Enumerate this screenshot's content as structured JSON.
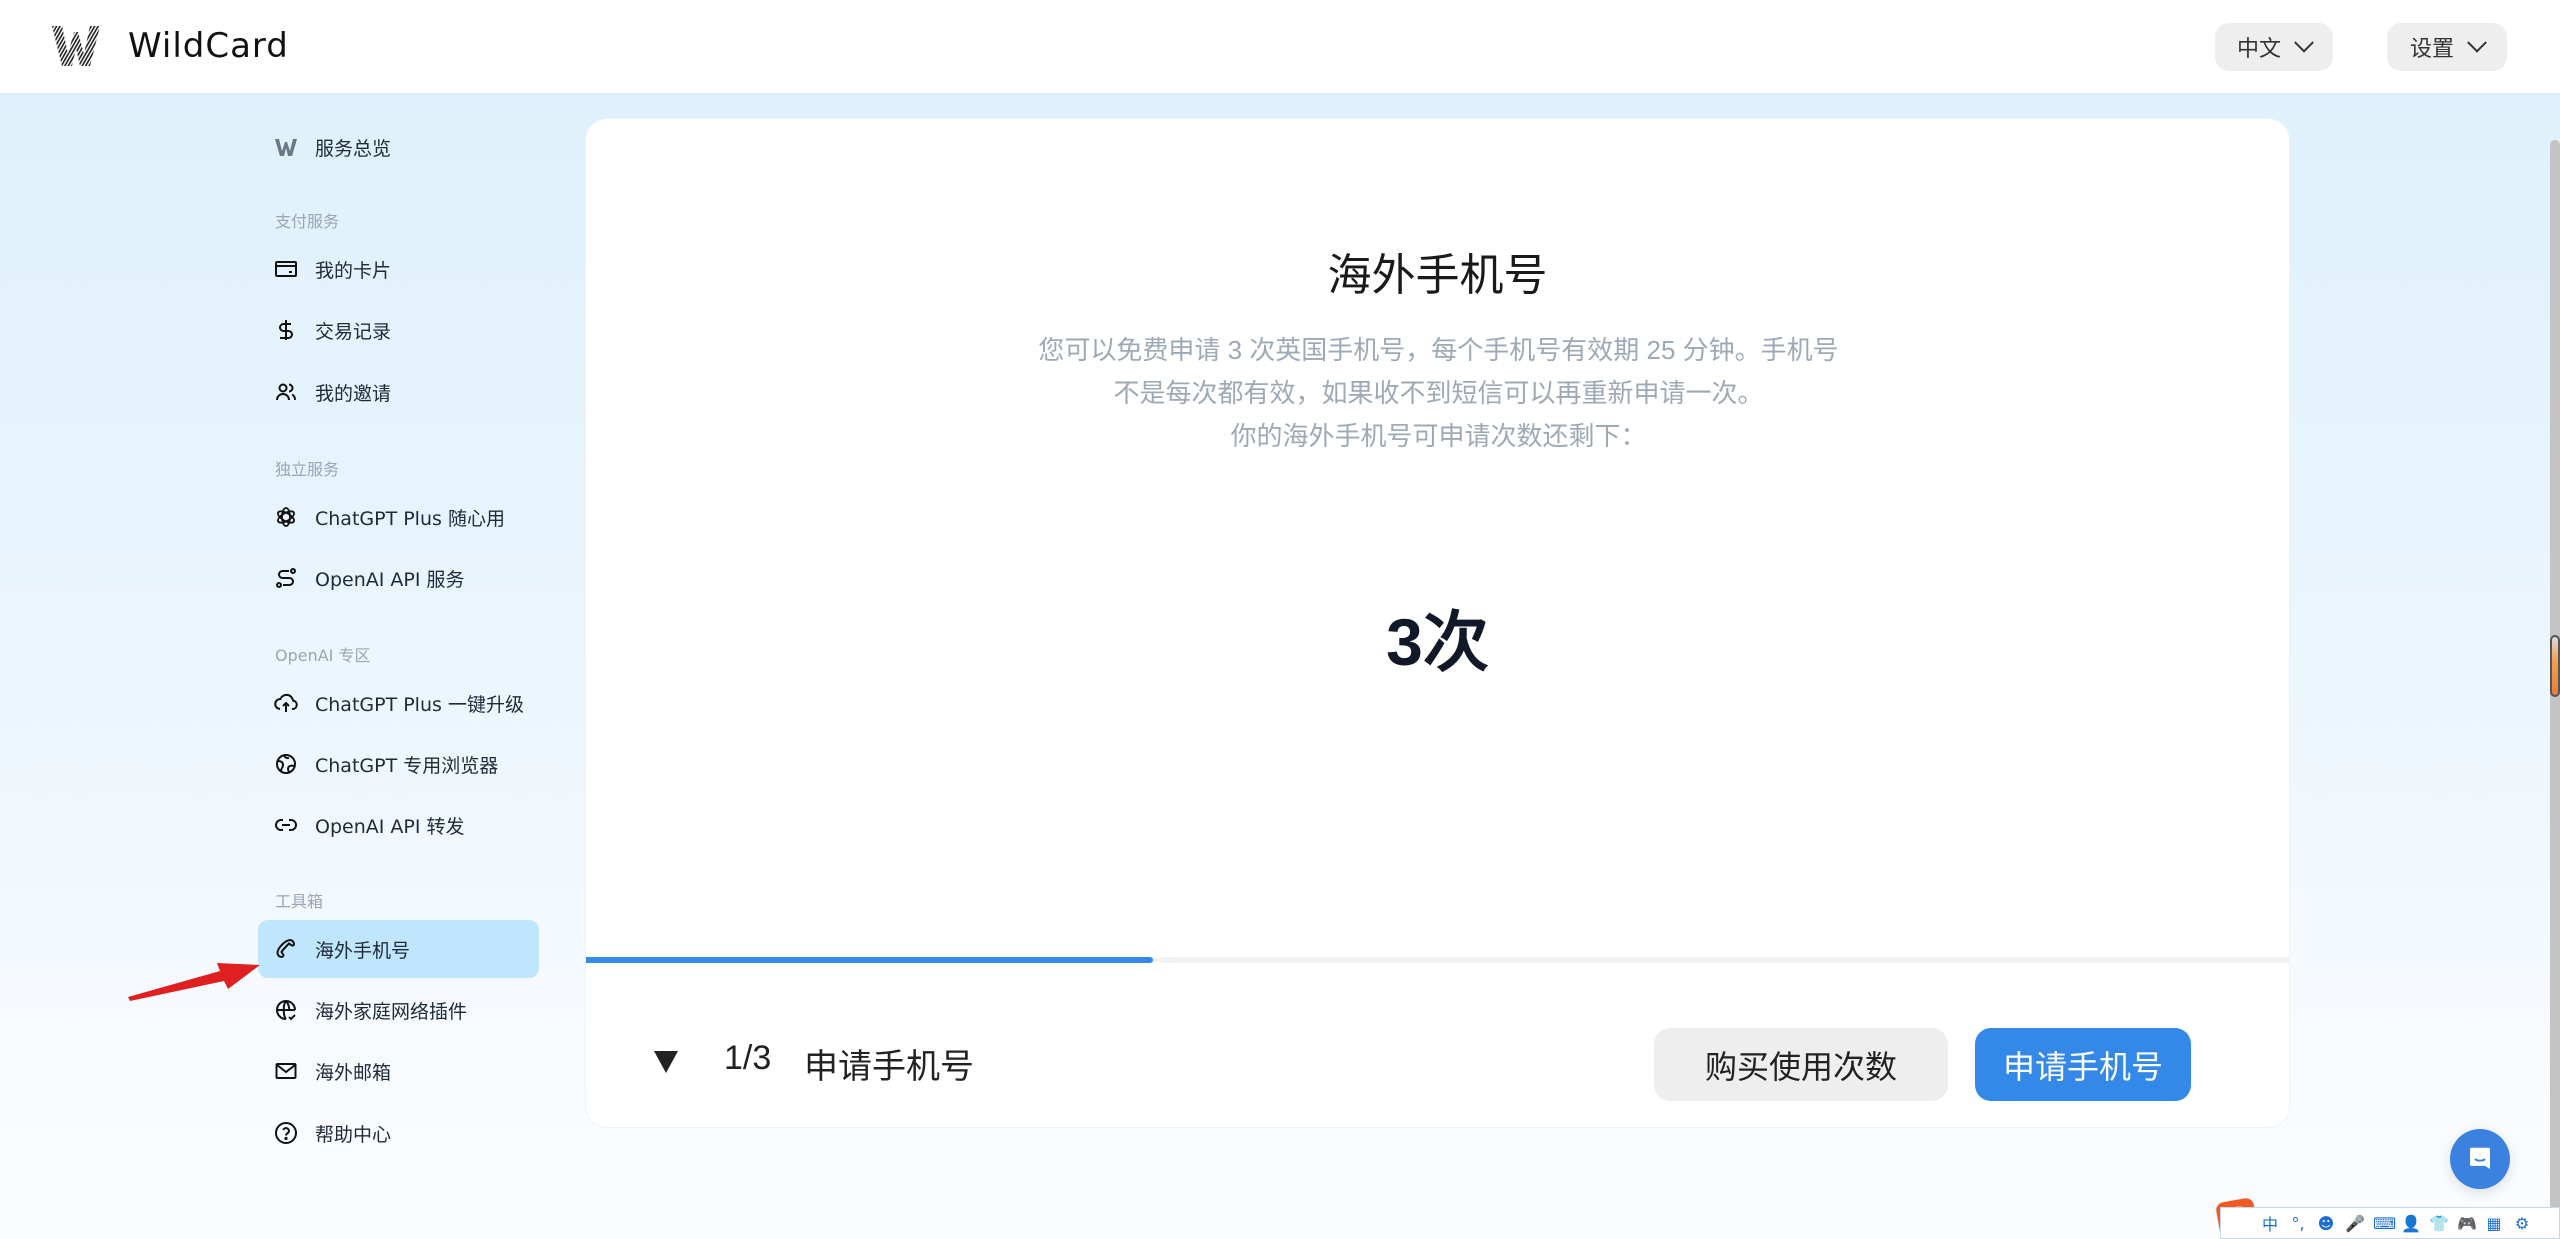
{
  "header": {
    "brand": "WildCard",
    "language_button": "中文",
    "settings_button": "设置"
  },
  "sidebar": {
    "overview": {
      "label": "服务总览",
      "icon": "wildcard-logo-icon"
    },
    "sections": [
      {
        "title": "支付服务",
        "items": [
          {
            "label": "我的卡片",
            "icon": "credit-card-icon"
          },
          {
            "label": "交易记录",
            "icon": "dollar-icon"
          },
          {
            "label": "我的邀请",
            "icon": "users-icon"
          }
        ]
      },
      {
        "title": "独立服务",
        "items": [
          {
            "label": "ChatGPT Plus 随心用",
            "icon": "openai-icon"
          },
          {
            "label": "OpenAI API 服务",
            "icon": "route-icon"
          }
        ]
      },
      {
        "title": "OpenAI 专区",
        "items": [
          {
            "label": "ChatGPT Plus 一键升级",
            "icon": "cloud-upload-icon"
          },
          {
            "label": "ChatGPT 专用浏览器",
            "icon": "browser-globe-icon"
          },
          {
            "label": "OpenAI API 转发",
            "icon": "link-icon"
          }
        ]
      },
      {
        "title": "工具箱",
        "items": [
          {
            "label": "海外手机号",
            "icon": "phone-icon",
            "active": true
          },
          {
            "label": "海外家庭网络插件",
            "icon": "globe-check-icon"
          },
          {
            "label": "海外邮箱",
            "icon": "mail-icon"
          },
          {
            "label": "帮助中心",
            "icon": "help-circle-icon"
          }
        ]
      }
    ]
  },
  "main": {
    "title": "海外手机号",
    "description_lines": [
      "您可以免费申请 3 次英国手机号，每个手机号有效期 25 分钟。手机号",
      "不是每次都有效，如果收不到短信可以再重新申请一次。",
      "你的海外手机号可申请次数还剩下："
    ],
    "remaining_count": "3次",
    "progress": {
      "current_step": 1,
      "total_steps": 3,
      "fraction": 0.333
    },
    "step_count_text": "1/3",
    "step_label": "申请手机号",
    "buy_button": "购买使用次数",
    "apply_button": "申请手机号"
  },
  "colors": {
    "accent": "#3388e8",
    "active_nav_bg": "#bfe6fc",
    "annotation_arrow": "#e02020"
  },
  "ime_toolbar": {
    "logo": "S",
    "items": [
      "中",
      "°,",
      "☻",
      "🎤",
      "⌨",
      "👤",
      "👕",
      "🎮",
      "▦",
      "⚙"
    ]
  }
}
